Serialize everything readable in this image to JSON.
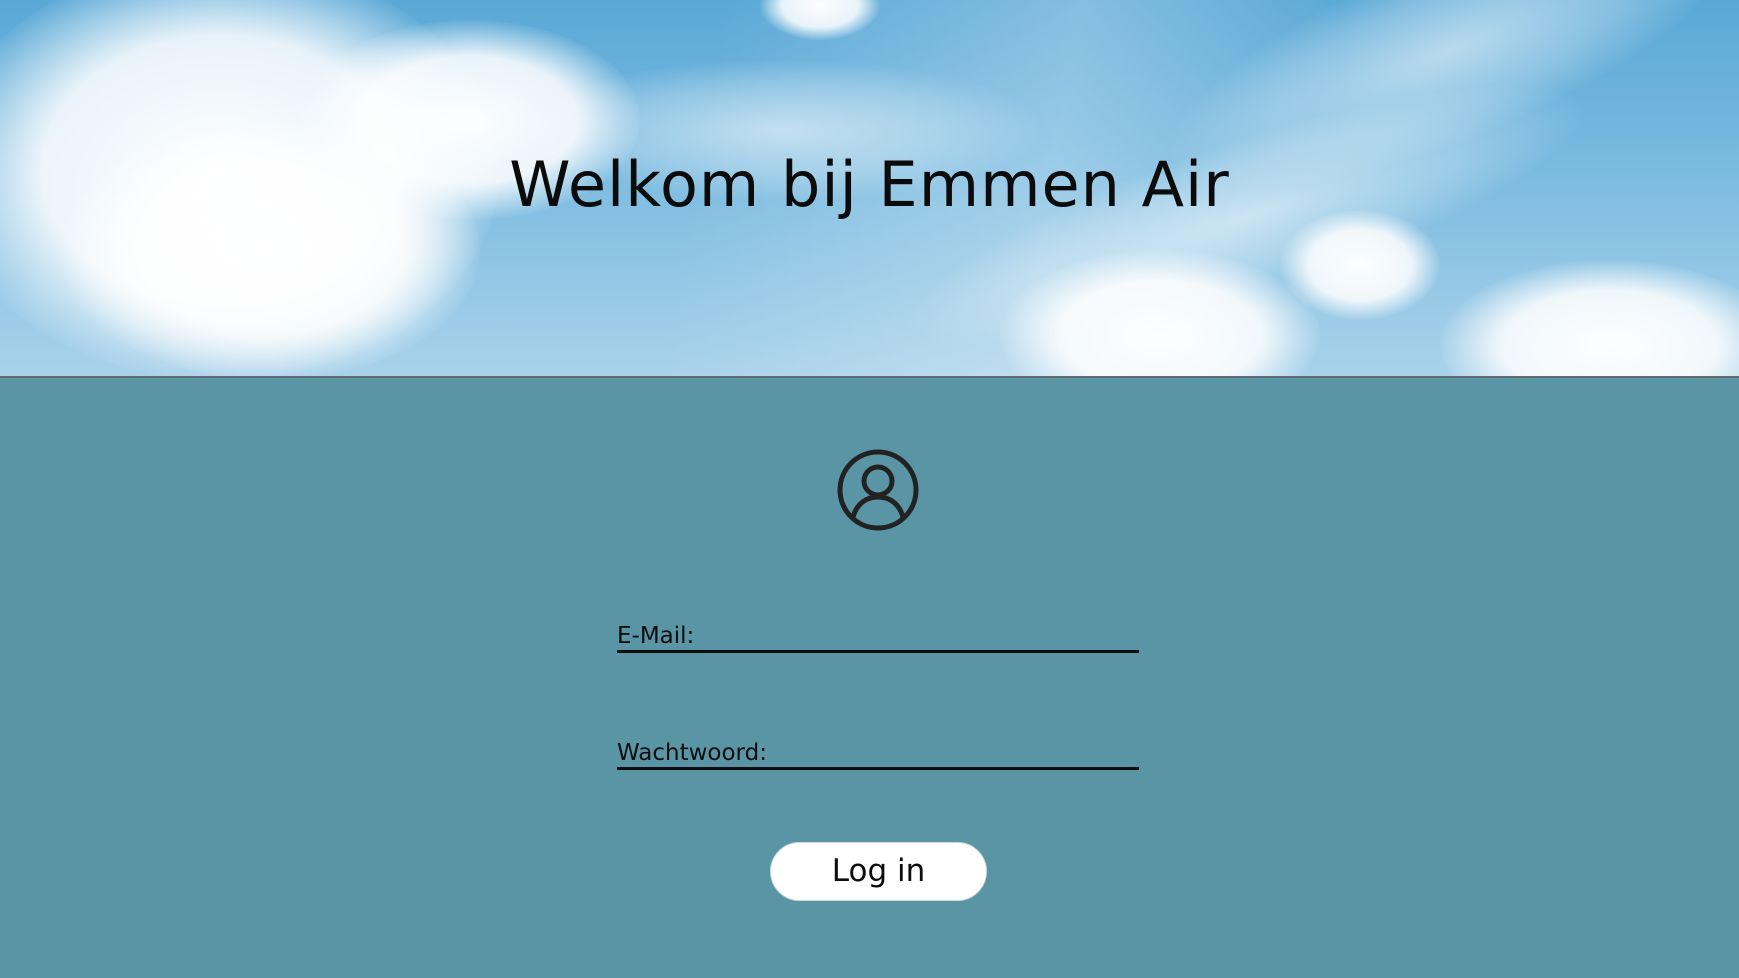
{
  "header": {
    "title": "Welkom bij Emmen Air",
    "background": "sky-clouds-image"
  },
  "login": {
    "avatar_icon": "user-circle-icon",
    "email_label": "E-Mail:",
    "email_value": "",
    "password_label": "Wachtwoord:",
    "password_value": "",
    "submit_label": "Log in"
  },
  "colors": {
    "panel_background": "#5a95a5",
    "button_background": "#ffffff",
    "text": "#0d0d0d"
  }
}
